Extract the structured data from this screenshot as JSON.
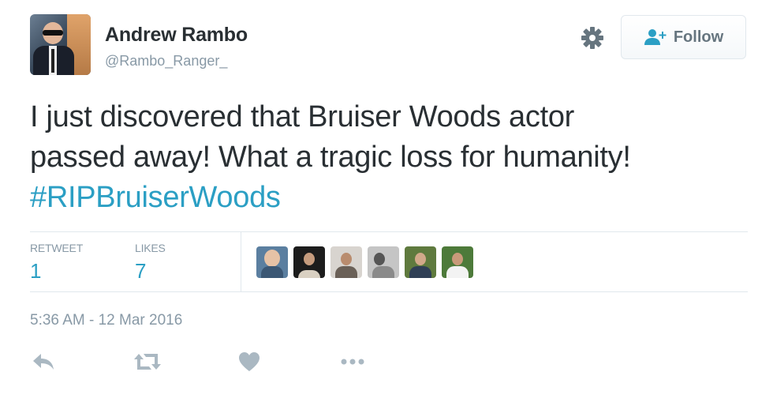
{
  "user": {
    "display_name": "Andrew Rambo",
    "handle": "@Rambo_Ranger_"
  },
  "header": {
    "follow_label": "Follow",
    "settings_icon": "gear-icon",
    "follow_icon": "person-plus-icon"
  },
  "tweet": {
    "text_line1": "I just discovered that Bruiser Woods actor",
    "text_line2": "passed away! What a tragic loss for humanity!",
    "hashtag": "#RIPBruiserWoods"
  },
  "stats": {
    "retweets_label": "RETWEET",
    "retweets_value": "1",
    "likes_label": "LIKES",
    "likes_value": "7"
  },
  "likers_count_shown": 6,
  "timestamp": "5:36 AM - 12 Mar 2016",
  "actions": {
    "reply_icon": "reply-icon",
    "retweet_icon": "retweet-icon",
    "like_icon": "heart-icon",
    "more_icon": "more-icon"
  },
  "colors": {
    "link": "#2b9fc4",
    "muted": "#8899a6",
    "text": "#292f33",
    "border": "#e1e8ed",
    "icon": "#aab8c2"
  }
}
